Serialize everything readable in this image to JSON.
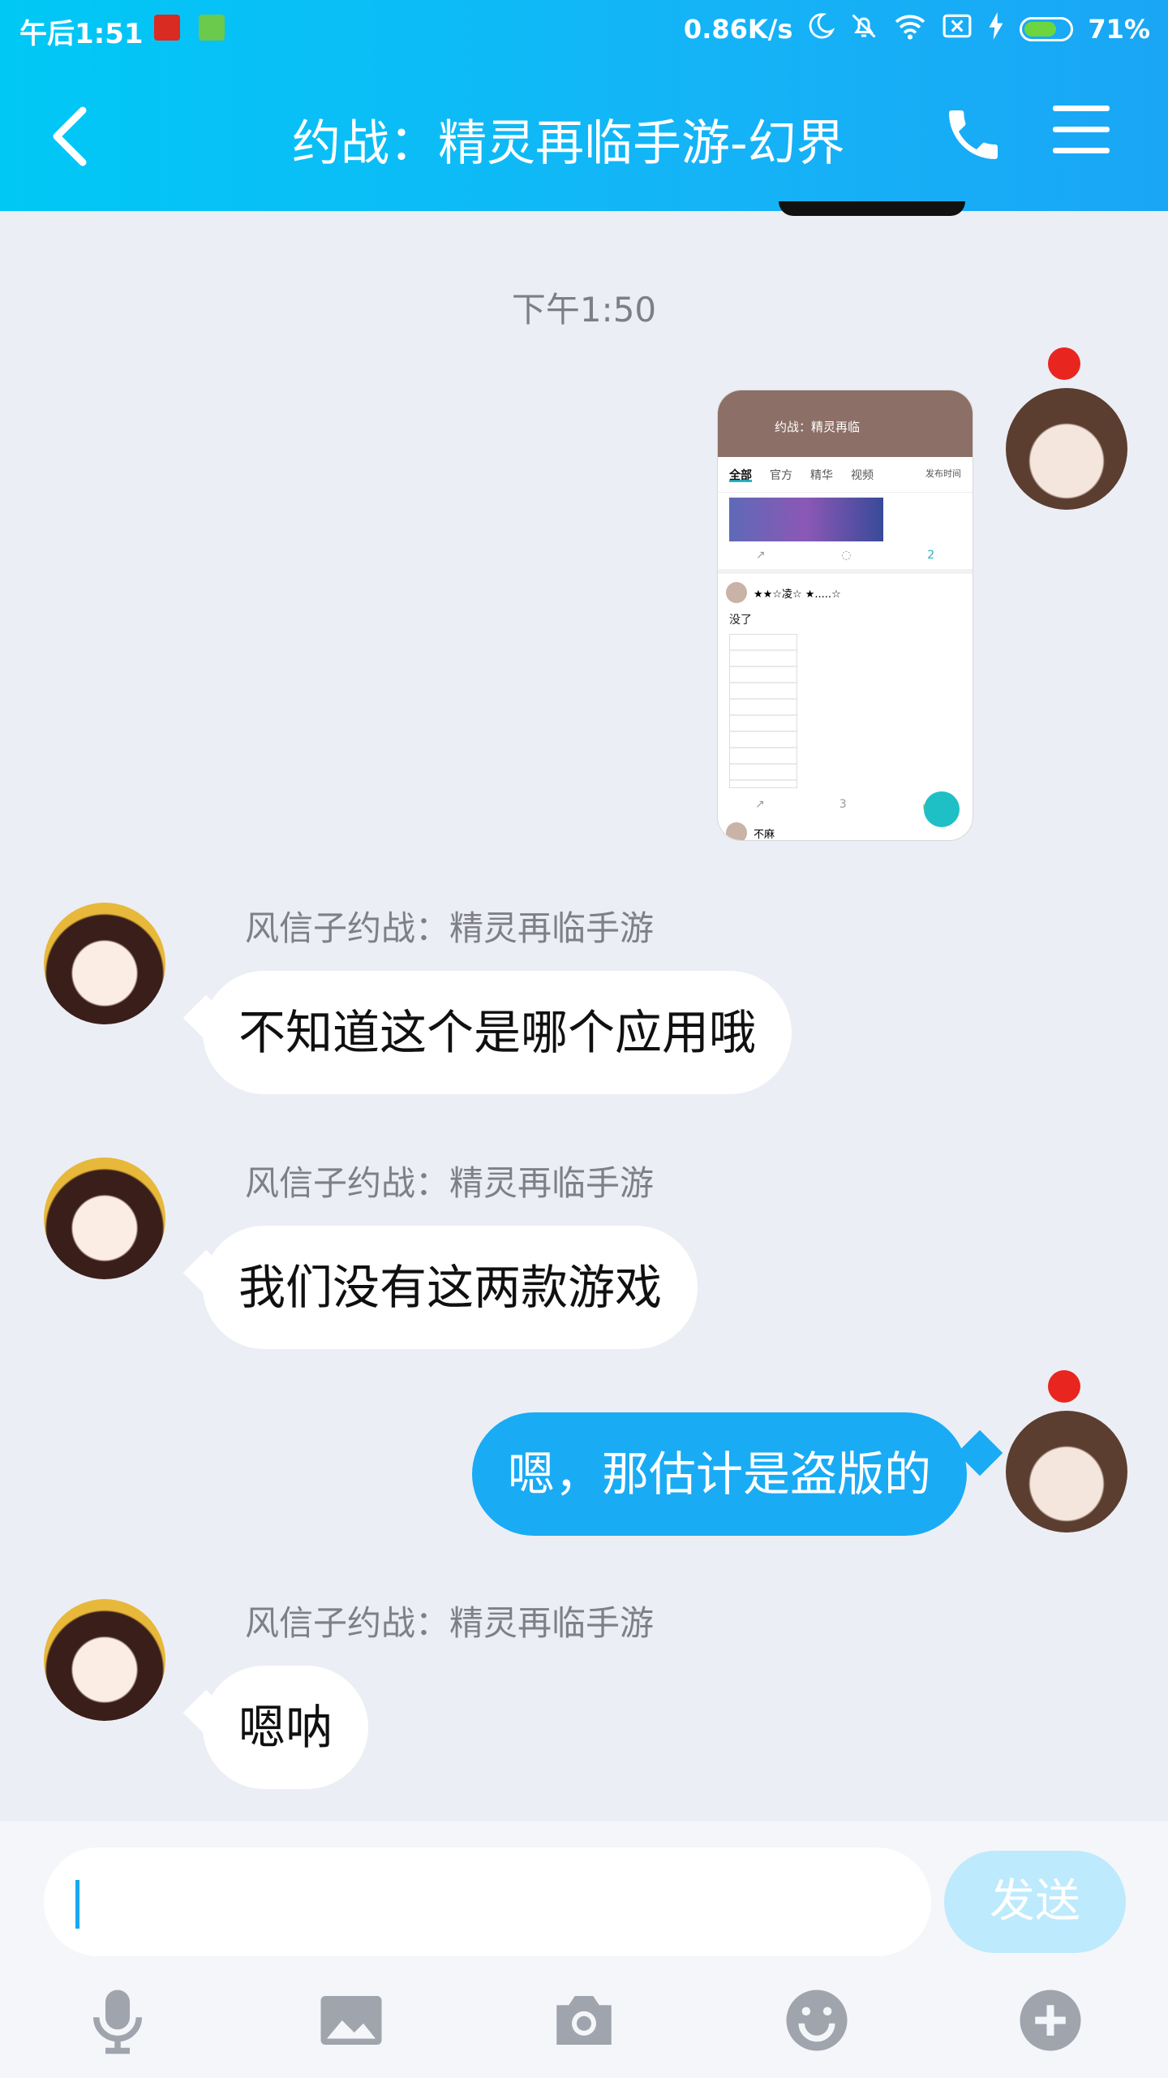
{
  "status_bar": {
    "time": "午后1:51",
    "network_speed": "0.86K/s",
    "battery_percent": "71%",
    "battery_level": 0.71
  },
  "nav": {
    "title": "约战：精灵再临手游-幻界"
  },
  "chat": {
    "timestamp": "下午1:50",
    "thumbnail": {
      "header_title": "约战：精灵再临",
      "tabs": [
        "全部",
        "官方",
        "精华",
        "视频"
      ],
      "sort_label": "发布时间",
      "poster_name": "★★☆凌☆ ★.....☆",
      "post_text": "没了",
      "like_count": "2",
      "comment_count": "3",
      "next_user": "不麻"
    },
    "messages": [
      {
        "sender": "风信子约战：精灵再临手游",
        "text": "不知道这个是哪个应用哦"
      },
      {
        "sender": "风信子约战：精灵再临手游",
        "text": "我们没有这两款游戏"
      },
      {
        "sender": "me",
        "text": "嗯，那估计是盗版的"
      },
      {
        "sender": "风信子约战：精灵再临手游",
        "text": "嗯呐"
      }
    ]
  },
  "input": {
    "value": "",
    "placeholder": "",
    "send_label": "发送"
  },
  "toolbar": {
    "icons": [
      "microphone-icon",
      "image-icon",
      "camera-icon",
      "emoji-icon",
      "plus-icon"
    ]
  },
  "colors": {
    "header_start": "#00c8f5",
    "header_end": "#1aa6f5",
    "outgoing_bubble": "#1aabf5",
    "background": "#eceef5",
    "send_button": "#bdeafd"
  }
}
